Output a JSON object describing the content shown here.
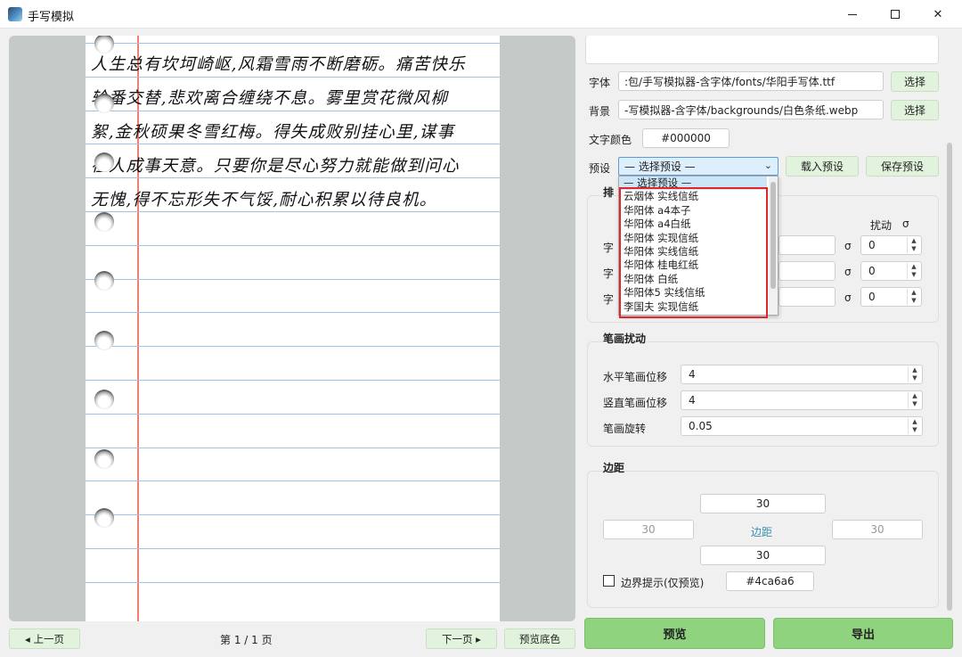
{
  "window": {
    "title": "手写模拟",
    "icons": [
      "app-icon",
      "minimize-icon",
      "maximize-icon",
      "close-icon"
    ]
  },
  "preview": {
    "lines": [
      "人生总有坎坷崎岖,风霜雪雨不断磨砺。痛苦快乐",
      "轮番交替,悲欢离合缠绕不息。雾里赏花微风柳",
      "絮,金秋硕果冬雪红梅。得失成败别挂心里,谋事",
      "在人成事天意。只要你是尽心努力就能做到问心",
      "无愧,得不忘形失不气馁,耐心积累以待良机。"
    ],
    "colors": {
      "margin_line": "#f07f6e",
      "rule_line": "#9ec3e6",
      "ink": "#111111"
    }
  },
  "nav": {
    "prev_label": "◂ 上一页",
    "page_indicator": "第 1 / 1 页",
    "next_label": "下一页 ▸",
    "preview_bg_label": "预览底色"
  },
  "settings": {
    "font_label": "字体",
    "font_path": ":包/手写模拟器-含字体/fonts/华阳手写体.ttf",
    "font_select": "选择",
    "bg_label": "背景",
    "bg_path": "-写模拟器-含字体/backgrounds/白色条纸.webp",
    "bg_select": "选择",
    "color_label": "文字颜色",
    "color_value": "#000000",
    "preset_label": "预设",
    "preset_value": "— 选择预设 —",
    "load_preset": "载入预设",
    "save_preset": "保存预设"
  },
  "preset_options": [
    "— 选择预设 —",
    "云烟体 实线信纸",
    "华阳体 a4本子",
    "华阳体 a4白纸",
    "华阳体 实现信纸",
    "华阳体 实线信纸",
    "华阳体 桂电红纸",
    "华阳体 白纸",
    "华阳体5 实线信纸",
    "李国夫 实现信纸"
  ],
  "layout_group": {
    "title_partial": "排",
    "disturb_header": "扰动",
    "sigma_header": "σ",
    "row_label_partial": "字",
    "rows": [
      {
        "sigma": "σ",
        "value": "0"
      },
      {
        "sigma": "σ",
        "value": "0"
      },
      {
        "sigma": "σ",
        "value": "0"
      }
    ]
  },
  "stroke_group": {
    "title": "笔画扰动",
    "rows": [
      {
        "label": "水平笔画位移",
        "value": "4"
      },
      {
        "label": "竖直笔画位移",
        "value": "4"
      },
      {
        "label": "笔画旋转",
        "value": "0.05"
      }
    ]
  },
  "margin_group": {
    "title": "边距",
    "top": "30",
    "left": "30",
    "center_label": "边距",
    "right": "30",
    "bottom": "30",
    "hint_label": "边界提示(仅预览)",
    "hint_checked": false,
    "hint_color": "#4ca6a6"
  },
  "actions": {
    "preview": "预览",
    "export": "导出"
  }
}
